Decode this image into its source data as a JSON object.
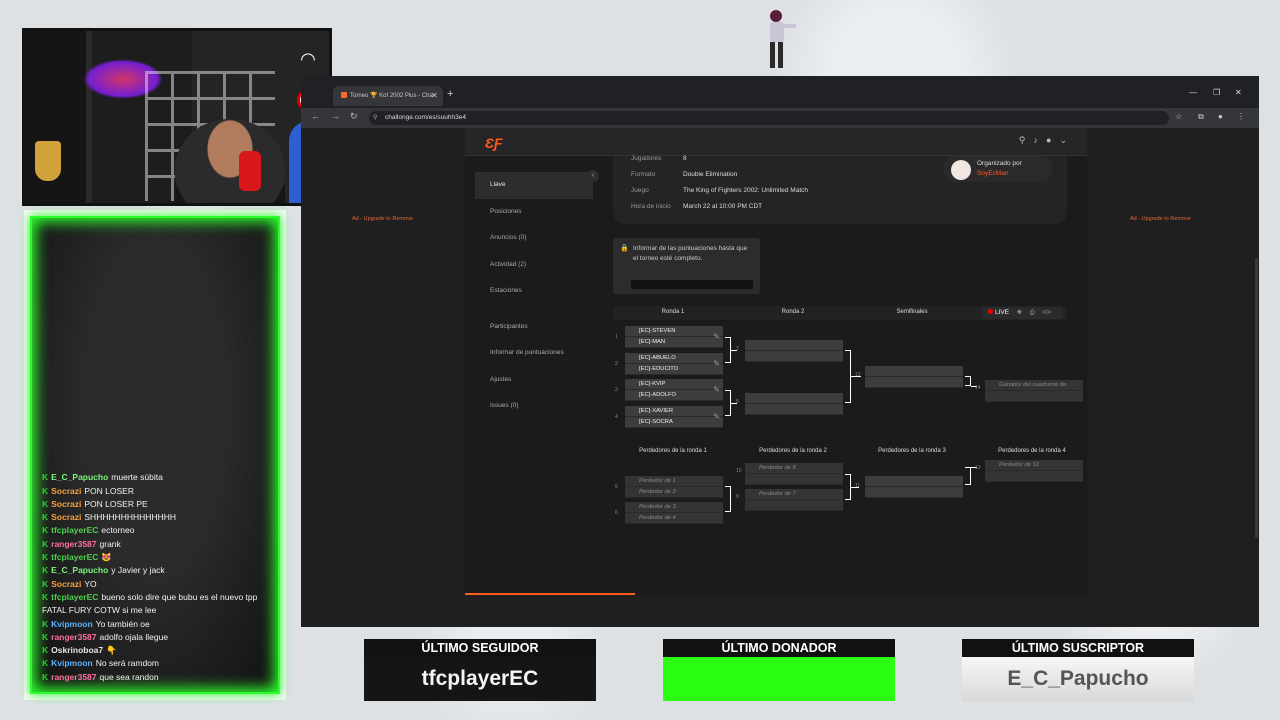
{
  "stream": {
    "chat": [
      {
        "user": "E_C_Papucho",
        "color": "#7cf37c",
        "text": "muerte súbita"
      },
      {
        "user": "Socrazi",
        "color": "#f7a23a",
        "text": "PON LOSER"
      },
      {
        "user": "Socrazi",
        "color": "#f7a23a",
        "text": "PON LOSER PE"
      },
      {
        "user": "Socrazi",
        "color": "#f7a23a",
        "text": "SHHHHHHHHHHHHHH"
      },
      {
        "user": "tfcplayerEC",
        "color": "#4cd44c",
        "text": "ectorneo"
      },
      {
        "user": "ranger3587",
        "color": "#ff6fa3",
        "text": "grank"
      },
      {
        "user": "tfcplayerEC",
        "color": "#4cd44c",
        "text": "😻"
      },
      {
        "user": "E_C_Papucho",
        "color": "#7cf37c",
        "text": "y Javier y jack"
      },
      {
        "user": "Socrazi",
        "color": "#f7a23a",
        "text": "YO"
      },
      {
        "user": "tfcplayerEC",
        "color": "#4cd44c",
        "text": "bueno solo dire que bubu es el nuevo tpp FATAL FURY COTW si me lee"
      },
      {
        "user": "Kvipmoon",
        "color": "#5ab3ff",
        "text": "Yo también oe"
      },
      {
        "user": "ranger3587",
        "color": "#ff6fa3",
        "text": "adolfo ojala llegue"
      },
      {
        "user": "Oskrinoboa7",
        "color": "#e6e6e6",
        "text": "👇"
      },
      {
        "user": "Kvipmoon",
        "color": "#5ab3ff",
        "text": "No será ramdom"
      },
      {
        "user": "ranger3587",
        "color": "#ff6fa3",
        "text": "que sea randon"
      }
    ],
    "chat_badge": "K",
    "stats": {
      "follower_title": "ÚLTIMO SEGUIDOR",
      "follower_value": "tfcplayerEC",
      "donor_title": "ÚLTIMO DONADOR",
      "donor_value": "",
      "sub_title": "ÚLTIMO SUSCRIPTOR",
      "sub_value": "E_C_Papucho"
    }
  },
  "browser": {
    "tab_title": "Torneo 🏆 Kof 2002 Plus - Cha",
    "url": "challonge.com/es/suuhh3e4",
    "icons": [
      "back-arrow",
      "forward-arrow",
      "reload",
      "star",
      "extensions",
      "profile",
      "menu"
    ]
  },
  "page": {
    "ad_text": "Ad - Upgrade to Remove",
    "sidebar": [
      {
        "label": "Llave",
        "active": true
      },
      {
        "label": "Posiciones"
      },
      {
        "label": "Anuncios (0)"
      },
      {
        "label": "Actividad (2)"
      },
      {
        "label": "Estaciones"
      },
      {
        "label": "Participantes"
      },
      {
        "label": "Informar de puntuaciones"
      },
      {
        "label": "Ajustes"
      },
      {
        "label": "Issues (0)"
      }
    ],
    "info": {
      "players_label": "Jugadores",
      "players": "8",
      "format_label": "Formato",
      "format": "Double Elimination",
      "game_label": "Juego",
      "game": "The King of Fighters 2002: Unlimited Match",
      "start_label": "Hora de inicio",
      "start": "March 22 at 10:00 PM CDT",
      "organized_label": "Organizado por",
      "organizer": "SoyEcMan"
    },
    "notice": "Informar de las puntuaciones hasta que el torneo esté completo.",
    "live": "LIVE",
    "rounds": [
      "Ronda 1",
      "Ronda 2",
      "Semifinales"
    ],
    "loser_rounds": [
      "Perdedores de la ronda 1",
      "Perdedores de la ronda 2",
      "Perdedores de la ronda 3",
      "Perdedores de la ronda 4"
    ],
    "winners_r1": [
      {
        "num": "1",
        "p1": "[EC]-STEVEN",
        "p2": "[EC]-MAN"
      },
      {
        "num": "2",
        "p1": "[EC]-ABUELO",
        "p2": "[EC]-EDUCITO"
      },
      {
        "num": "3",
        "p1": "[EC]-KVIP",
        "p2": "[EC]-ADOLFO"
      },
      {
        "num": "4",
        "p1": "[EC]-XAVIER",
        "p2": "[EC]-SOCRA"
      }
    ],
    "winners_r2_nums": [
      "7",
      "8"
    ],
    "semi_num": "12",
    "final_num": "14",
    "final_placeholder": "Ganador del cuadrante de",
    "losers_r1": [
      {
        "num": "5",
        "p1": "Perdedor de 1",
        "p2": "Perdedor de 2"
      },
      {
        "num": "6",
        "p1": "Perdedor de 3",
        "p2": "Perdedor de 4"
      }
    ],
    "losers_r2": [
      {
        "num": "10",
        "p1": "Perdedor de 8"
      },
      {
        "num": "9",
        "p1": "Perdedor de 7"
      }
    ],
    "losers_r3_num": "11",
    "losers_r4": {
      "num": "13",
      "p1": "Perdedor de 12"
    }
  }
}
